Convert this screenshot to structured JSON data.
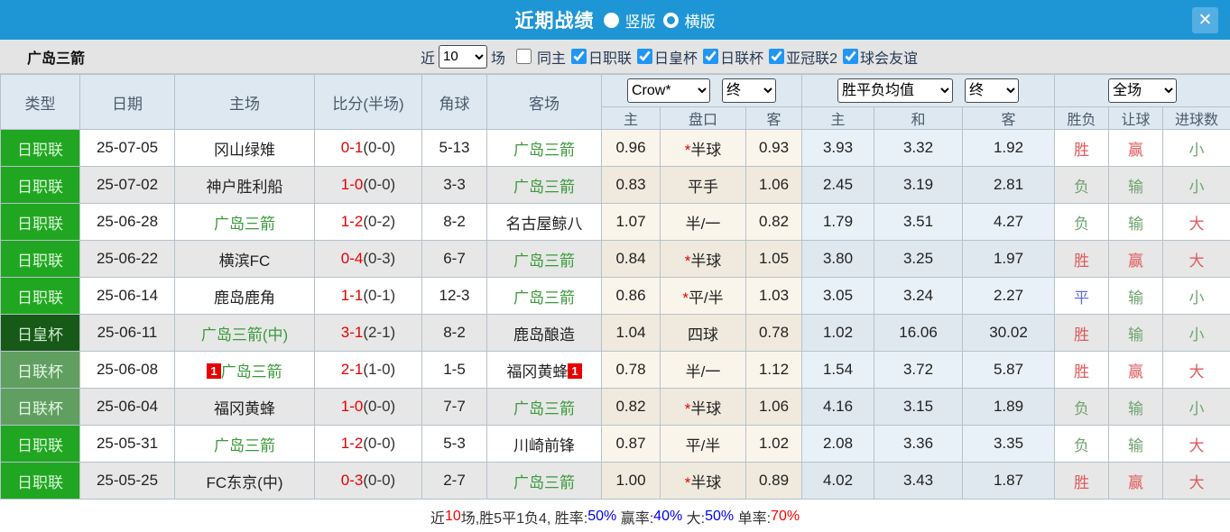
{
  "title_bar": {
    "title": "近期战绩",
    "radios": [
      {
        "label": "竖版",
        "selected": true
      },
      {
        "label": "横版",
        "selected": false
      }
    ],
    "close_icon": "✕"
  },
  "filter_bar": {
    "team": "广岛三箭",
    "near_label": "近",
    "matches_value": "10",
    "matches_label": "场",
    "checkboxes": [
      {
        "label": "同主",
        "checked": false
      },
      {
        "label": "日职联",
        "checked": true
      },
      {
        "label": "日皇杯",
        "checked": true
      },
      {
        "label": "日联杯",
        "checked": true
      },
      {
        "label": "亚冠联2",
        "checked": true
      },
      {
        "label": "球会友谊",
        "checked": true
      }
    ]
  },
  "table": {
    "headers": {
      "type": "类型",
      "date": "日期",
      "home": "主场",
      "score": "比分(半场)",
      "corner": "角球",
      "away": "客场"
    },
    "selects": {
      "odds_source": "Crow*",
      "odds_final_1": "终",
      "avg": "胜平负均值",
      "odds_final_2": "终",
      "scope": "全场"
    },
    "subheaders": [
      "主",
      "盘口",
      "客",
      "主",
      "和",
      "客",
      "胜负",
      "让球",
      "进球数"
    ],
    "rows": [
      {
        "type": "日职联",
        "type_style": "j1",
        "date": "25-07-05",
        "home": "冈山绿雉",
        "home_green": false,
        "home_badge": "",
        "score_ft": "0-1",
        "score_ht": "(0-0)",
        "corner": "5-13",
        "away": "广岛三箭",
        "away_green": true,
        "away_badge": "",
        "ah_home": "0.96",
        "line_star": "*",
        "line": "半球",
        "ah_away": "0.93",
        "eu_home": "3.93",
        "eu_draw": "3.32",
        "eu_away": "1.92",
        "wdl": "胜",
        "wdl_color": "red",
        "let": "赢",
        "let_color": "red",
        "goal": "小",
        "goal_color": "green"
      },
      {
        "type": "日职联",
        "type_style": "j1",
        "date": "25-07-02",
        "home": "神户胜利船",
        "home_green": false,
        "home_badge": "",
        "score_ft": "1-0",
        "score_ht": "(0-0)",
        "corner": "3-3",
        "away": "广岛三箭",
        "away_green": true,
        "away_badge": "",
        "ah_home": "0.83",
        "line_star": "",
        "line": "平手",
        "ah_away": "1.06",
        "eu_home": "2.45",
        "eu_draw": "3.19",
        "eu_away": "2.81",
        "wdl": "负",
        "wdl_color": "green",
        "let": "输",
        "let_color": "green",
        "goal": "小",
        "goal_color": "green"
      },
      {
        "type": "日职联",
        "type_style": "j1",
        "date": "25-06-28",
        "home": "广岛三箭",
        "home_green": true,
        "home_badge": "",
        "score_ft": "1-2",
        "score_ht": "(0-2)",
        "corner": "8-2",
        "away": "名古屋鲸八",
        "away_green": false,
        "away_badge": "",
        "ah_home": "1.07",
        "line_star": "",
        "line": "半/一",
        "ah_away": "0.82",
        "eu_home": "1.79",
        "eu_draw": "3.51",
        "eu_away": "4.27",
        "wdl": "负",
        "wdl_color": "green",
        "let": "输",
        "let_color": "green",
        "goal": "大",
        "goal_color": "red"
      },
      {
        "type": "日职联",
        "type_style": "j1",
        "date": "25-06-22",
        "home": "横滨FC",
        "home_green": false,
        "home_badge": "",
        "score_ft": "0-4",
        "score_ht": "(0-3)",
        "corner": "6-7",
        "away": "广岛三箭",
        "away_green": true,
        "away_badge": "",
        "ah_home": "0.84",
        "line_star": "*",
        "line": "半球",
        "ah_away": "1.05",
        "eu_home": "3.80",
        "eu_draw": "3.25",
        "eu_away": "1.97",
        "wdl": "胜",
        "wdl_color": "red",
        "let": "赢",
        "let_color": "red",
        "goal": "大",
        "goal_color": "red"
      },
      {
        "type": "日职联",
        "type_style": "j1",
        "date": "25-06-14",
        "home": "鹿岛鹿角",
        "home_green": false,
        "home_badge": "",
        "score_ft": "1-1",
        "score_ht": "(0-1)",
        "corner": "12-3",
        "away": "广岛三箭",
        "away_green": true,
        "away_badge": "",
        "ah_home": "0.86",
        "line_star": "*",
        "line": "平/半",
        "ah_away": "1.03",
        "eu_home": "3.05",
        "eu_draw": "3.24",
        "eu_away": "2.27",
        "wdl": "平",
        "wdl_color": "blue",
        "let": "输",
        "let_color": "green",
        "goal": "小",
        "goal_color": "green"
      },
      {
        "type": "日皇杯",
        "type_style": "emperor",
        "date": "25-06-11",
        "home": "广岛三箭(中)",
        "home_green": true,
        "home_badge": "",
        "score_ft": "3-1",
        "score_ht": "(2-1)",
        "corner": "8-2",
        "away": "鹿岛酿造",
        "away_green": false,
        "away_badge": "",
        "ah_home": "1.04",
        "line_star": "",
        "line": "四球",
        "ah_away": "0.78",
        "eu_home": "1.02",
        "eu_draw": "16.06",
        "eu_away": "30.02",
        "wdl": "胜",
        "wdl_color": "red",
        "let": "输",
        "let_color": "green",
        "goal": "小",
        "goal_color": "green"
      },
      {
        "type": "日联杯",
        "type_style": "levain",
        "date": "25-06-08",
        "home": "广岛三箭",
        "home_green": true,
        "home_badge": "1",
        "score_ft": "2-1",
        "score_ht": "(1-0)",
        "corner": "1-5",
        "away": "福冈黄蜂",
        "away_green": false,
        "away_badge": "1",
        "ah_home": "0.78",
        "line_star": "",
        "line": "半/一",
        "ah_away": "1.12",
        "eu_home": "1.54",
        "eu_draw": "3.72",
        "eu_away": "5.87",
        "wdl": "胜",
        "wdl_color": "red",
        "let": "赢",
        "let_color": "red",
        "goal": "大",
        "goal_color": "red"
      },
      {
        "type": "日联杯",
        "type_style": "levain",
        "date": "25-06-04",
        "home": "福冈黄蜂",
        "home_green": false,
        "home_badge": "",
        "score_ft": "1-0",
        "score_ht": "(0-0)",
        "corner": "7-7",
        "away": "广岛三箭",
        "away_green": true,
        "away_badge": "",
        "ah_home": "0.82",
        "line_star": "*",
        "line": "半球",
        "ah_away": "1.06",
        "eu_home": "4.16",
        "eu_draw": "3.15",
        "eu_away": "1.89",
        "wdl": "负",
        "wdl_color": "green",
        "let": "输",
        "let_color": "green",
        "goal": "小",
        "goal_color": "green"
      },
      {
        "type": "日职联",
        "type_style": "j1",
        "date": "25-05-31",
        "home": "广岛三箭",
        "home_green": true,
        "home_badge": "",
        "score_ft": "1-2",
        "score_ht": "(0-0)",
        "corner": "5-3",
        "away": "川崎前锋",
        "away_green": false,
        "away_badge": "",
        "ah_home": "0.87",
        "line_star": "",
        "line": "平/半",
        "ah_away": "1.02",
        "eu_home": "2.08",
        "eu_draw": "3.36",
        "eu_away": "3.35",
        "wdl": "负",
        "wdl_color": "green",
        "let": "输",
        "let_color": "green",
        "goal": "大",
        "goal_color": "red"
      },
      {
        "type": "日职联",
        "type_style": "j1",
        "date": "25-05-25",
        "home": "FC东京(中)",
        "home_green": false,
        "home_badge": "",
        "score_ft": "0-3",
        "score_ht": "(0-0)",
        "corner": "2-7",
        "away": "广岛三箭",
        "away_green": true,
        "away_badge": "",
        "ah_home": "1.00",
        "line_star": "*",
        "line": "半球",
        "ah_away": "0.89",
        "eu_home": "4.02",
        "eu_draw": "3.43",
        "eu_away": "1.87",
        "wdl": "胜",
        "wdl_color": "red",
        "let": "赢",
        "let_color": "red",
        "goal": "大",
        "goal_color": "red"
      }
    ]
  },
  "footer": {
    "segments": [
      {
        "text": "近",
        "color": "black"
      },
      {
        "text": "10",
        "color": "red"
      },
      {
        "text": "场,胜5平1负4, ",
        "color": "black"
      },
      {
        "text": "胜率:",
        "color": "black"
      },
      {
        "text": "50%",
        "color": "blue"
      },
      {
        "text": " 赢率:",
        "color": "black"
      },
      {
        "text": "40%",
        "color": "blue"
      },
      {
        "text": " 大:",
        "color": "black"
      },
      {
        "text": "50%",
        "color": "blue"
      },
      {
        "text": " 单率:",
        "color": "black"
      },
      {
        "text": "70%",
        "color": "red"
      }
    ]
  },
  "colors": {
    "topbar_blue": "#1e96d5",
    "close_button_blue": "#54aee2",
    "checkbox_blue": "#2196f3",
    "j1_league_green": "#21a621",
    "emperor_cup_green": "#175917",
    "levain_cup_green": "#609f60",
    "team_green": "#3a9a3a",
    "score_red": "#e80000",
    "result_red": "#e05a5a",
    "result_green": "#6da46d",
    "result_blue": "#5f6fd8",
    "footer_blue": "#0000ee",
    "footer_red": "#ff0000"
  }
}
